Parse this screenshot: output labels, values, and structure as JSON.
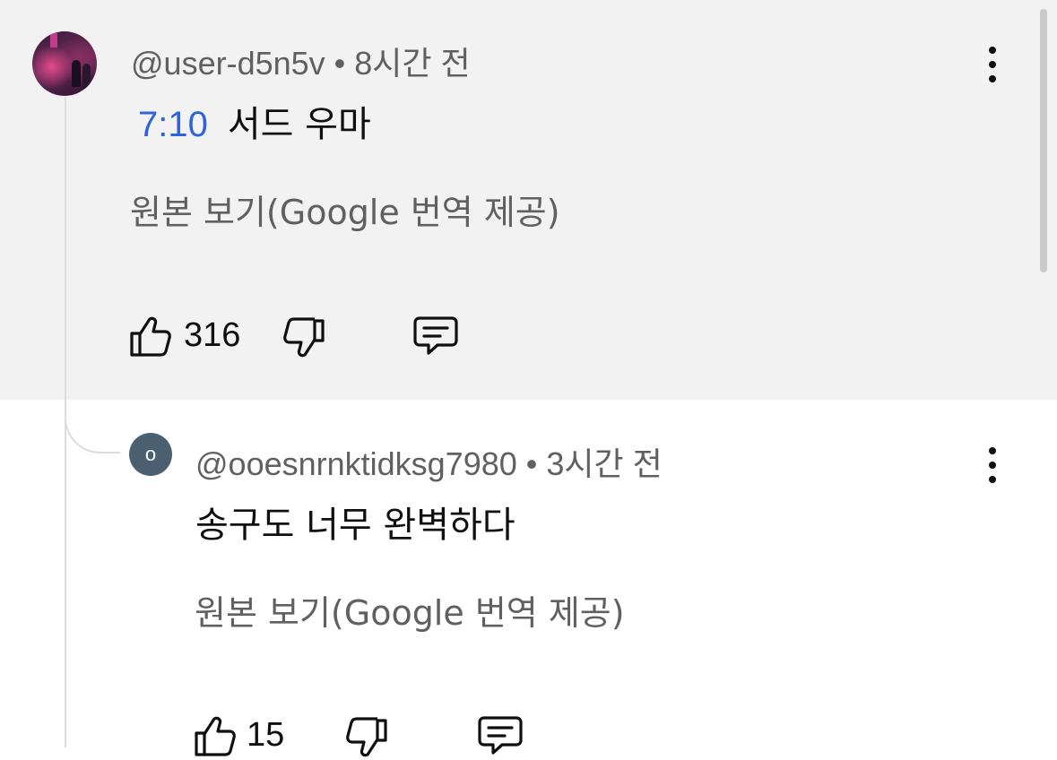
{
  "comments": [
    {
      "username": "@user-d5n5v",
      "separator": "•",
      "time_ago": "8시간 전",
      "timestamp_link": "7:10",
      "text": "서드 우마",
      "translate_label": "원본 보기(Google 번역 제공)",
      "like_count": "316",
      "avatar_icon": "profile-photo",
      "menu_icon": "more-vert-icon"
    },
    {
      "username": "@ooesnrnktidksg7980",
      "separator": "•",
      "time_ago": "3시간 전",
      "text": "송구도 너무 완벽하다",
      "translate_label": "원본 보기(Google 번역 제공)",
      "like_count": "15",
      "avatar_letter": "o",
      "avatar_color": "#4a5f70",
      "menu_icon": "more-vert-icon"
    }
  ],
  "colors": {
    "highlight_background": "#f2f2f2",
    "link_blue": "#2f64d8",
    "meta_gray": "#606060"
  }
}
